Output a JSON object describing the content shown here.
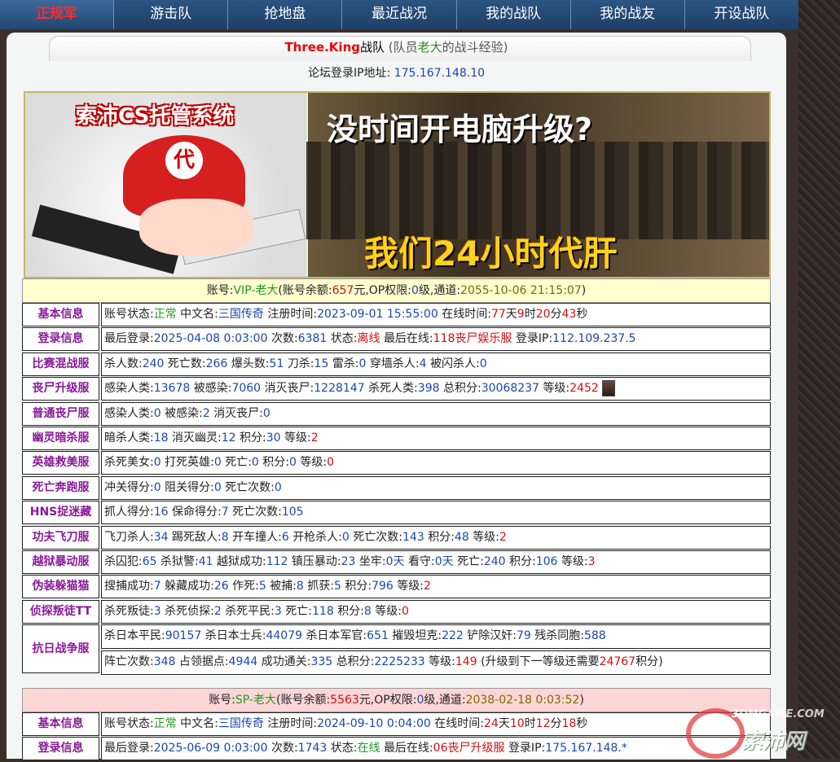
{
  "nav": {
    "items": [
      "正规军",
      "游击队",
      "抢地盘",
      "最近战况",
      "我的战队",
      "我的战友",
      "开设战队"
    ]
  },
  "title": {
    "team": "Three.King",
    "team_suffix": "战队",
    "paren_open": "(队员",
    "member": "老大",
    "paren_close": "的战斗经验)"
  },
  "ip_line": {
    "label": "论坛登录IP地址:",
    "ip": "175.167.148.10"
  },
  "banner": {
    "logo_text": "索沛CS托管系统",
    "badge": "代",
    "headline": "没时间开电脑升级?",
    "subline": "我们24小时代肝"
  },
  "vip_account": {
    "label": "账号:",
    "name": "VIP-老大",
    "balance_label": "(账号余额:",
    "balance": "657",
    "balance_unit": "元,OP权限:",
    "op": "0",
    "op_unit": "级,通道:",
    "channel": "2055-10-06 21:15:07",
    "close": ")"
  },
  "sp_account": {
    "label": "账号:",
    "name": "SP-老大",
    "balance_label": "(账号余额:",
    "balance": "5563",
    "balance_unit": "元,OP权限:",
    "op": "0",
    "op_unit": "级,通道:",
    "channel": "2038-02-18 0:03:52",
    "close": ")"
  },
  "vip_rows": {
    "basic": {
      "label": "基本信息",
      "status_label": "账号状态:",
      "status": "正常",
      "cn_label": "中文名:",
      "cn": "三国传奇",
      "reg_label": "注册时间:",
      "reg": "2023-09-01 15:55:00",
      "online_label": "在线时间:",
      "d": "77",
      "d_u": "天",
      "h": "9",
      "h_u": "时",
      "m": "20",
      "m_u": "分",
      "s": "43",
      "s_u": "秒"
    },
    "login": {
      "label": "登录信息",
      "last_label": "最后登录:",
      "last": "2025-04-08 0:03:00",
      "times_label": "次数:",
      "times": "6381",
      "state_label": "状态:",
      "state": "离线",
      "last_online_label": "最后在线:",
      "last_online": "118丧尸娱乐服",
      "ip_label": "登录IP:",
      "ip": "112.109.237.5"
    },
    "mix": {
      "label": "比赛混战服",
      "k_label": "杀人数:",
      "k": "240",
      "d_label": "死亡数:",
      "d": "266",
      "hs_label": "爆头数:",
      "hs": "51",
      "knife_label": "刀杀:",
      "knife": "15",
      "gren_label": "雷杀:",
      "gren": "0",
      "wall_label": "穿墙杀人:",
      "wall": "4",
      "flash_label": "被闪杀人:",
      "flash": "0"
    },
    "zombie_up": {
      "label": "丧尸升级服",
      "inf_label": "感染人类:",
      "inf": "13678",
      "infd_label": "被感染:",
      "infd": "7060",
      "kz_label": "消灭丧尸:",
      "kz": "1228147",
      "kh_label": "杀死人类:",
      "kh": "398",
      "score_label": "总积分:",
      "score": "30068237",
      "lv_label": "等级:",
      "lv": "2452"
    },
    "zombie": {
      "label": "普通丧尸服",
      "inf_label": "感染人类:",
      "inf": "0",
      "infd_label": "被感染:",
      "infd": "2",
      "kz_label": "消灭丧尸:",
      "kz": "0"
    },
    "ghost": {
      "label": "幽灵暗杀服",
      "a_label": "暗杀人类:",
      "a": "18",
      "b_label": "消灭幽灵:",
      "b": "12",
      "c_label": "积分:",
      "c": "30",
      "lv_label": "等级:",
      "lv": "2"
    },
    "hero": {
      "label": "英雄救美服",
      "a_label": "杀死美女:",
      "a": "0",
      "b_label": "打死英雄:",
      "b": "0",
      "c_label": "死亡:",
      "c": "0",
      "d_label": "积分:",
      "d": "0",
      "lv_label": "等级:",
      "lv": "0"
    },
    "run": {
      "label": "死亡奔跑服",
      "a_label": "冲关得分:",
      "a": "0",
      "b_label": "阻关得分:",
      "b": "0",
      "c_label": "死亡次数:",
      "c": "0"
    },
    "hns": {
      "label": "HNS捉迷藏",
      "a_label": "抓人得分:",
      "a": "16",
      "b_label": "保命得分:",
      "b": "7",
      "c_label": "死亡次数:",
      "c": "105"
    },
    "kungfu": {
      "label": "功夫飞刀服",
      "a_label": "飞刀杀人:",
      "a": "34",
      "b_label": "踢死敌人:",
      "b": "8",
      "c_label": "开车撞人:",
      "c": "6",
      "d_label": "开枪杀人:",
      "d": "0",
      "e_label": "死亡次数:",
      "e": "143",
      "f_label": "积分:",
      "f": "48",
      "lv_label": "等级:",
      "lv": "2"
    },
    "jail": {
      "label": "越狱暴动服",
      "a_label": "杀囚犯:",
      "a": "65",
      "b_label": "杀狱警:",
      "b": "41",
      "c_label": "越狱成功:",
      "c": "112",
      "d_label": "镇压暴动:",
      "d": "23",
      "e_label": "坐牢:",
      "e": "0天",
      "f_label": "看守:",
      "f": "0天",
      "g_label": "死亡:",
      "g": "240",
      "h_label": "积分:",
      "h": "106",
      "lv_label": "等级:",
      "lv": "3"
    },
    "prop": {
      "label": "伪装躲猫猫",
      "a_label": "搜捕成功:",
      "a": "7",
      "b_label": "躲藏成功:",
      "b": "26",
      "c_label": "作死:",
      "c": "5",
      "d_label": "被捕:",
      "d": "8",
      "e_label": "抓获:",
      "e": "5",
      "f_label": "积分:",
      "f": "796",
      "lv_label": "等级:",
      "lv": "2"
    },
    "tt": {
      "label": "侦探叛徒TT",
      "a_label": "杀死叛徒:",
      "a": "3",
      "b_label": "杀死侦探:",
      "b": "2",
      "c_label": "杀死平民:",
      "c": "3",
      "d_label": "死亡:",
      "d": "118",
      "e_label": "积分:",
      "e": "8",
      "lv_label": "等级:",
      "lv": "0"
    },
    "war": {
      "label": "抗日战争服",
      "a_label": "杀日本平民:",
      "a": "90157",
      "b_label": "杀日本士兵:",
      "b": "44079",
      "c_label": "杀日本军官:",
      "c": "651",
      "d_label": "摧毁坦克:",
      "d": "222",
      "e_label": "铲除汉奸:",
      "e": "79",
      "f_label": "残杀同胞:",
      "f": "588",
      "g_label": "阵亡次数:",
      "g": "348",
      "h_label": "占领据点:",
      "h": "4944",
      "i_label": "成功通关:",
      "i": "335",
      "j_label": "总积分:",
      "j": "2225233",
      "lv_label": "等级:",
      "lv": "149",
      "next_pre": "(升级到下一等级还需要",
      "next": "24767",
      "next_post": "积分)"
    }
  },
  "sp_rows": {
    "basic": {
      "label": "基本信息",
      "status_label": "账号状态:",
      "status": "正常",
      "cn_label": "中文名:",
      "cn": "三国传奇",
      "reg_label": "注册时间:",
      "reg": "2024-09-10 0:04:00",
      "online_label": "在线时间:",
      "d": "24",
      "d_u": "天",
      "h": "10",
      "h_u": "时",
      "m": "12",
      "m_u": "分",
      "s": "18",
      "s_u": "秒"
    },
    "login": {
      "label": "登录信息",
      "last_label": "最后登录:",
      "last": "2025-06-09 0:03:00",
      "times_label": "次数:",
      "times": "1743",
      "state_label": "状态:",
      "state": "在线",
      "last_online_label": "最后在线:",
      "last_online": "06丧尸升级服",
      "ip_label": "登录IP:",
      "ip": "175.167.148.*"
    }
  },
  "watermark": {
    "en": "3DMGAME.COM",
    "cn": "索沛网"
  }
}
